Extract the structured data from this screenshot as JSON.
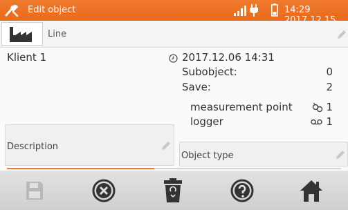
{
  "header": {
    "title": "Edit object",
    "datetime": "14:29 2017.12.15"
  },
  "line_field": {
    "label": "Line"
  },
  "object": {
    "client": "Klient 1",
    "created": "2017.12.06 14:31",
    "subobject_label": "Subobject:",
    "subobject_value": "0",
    "save_label": "Save:",
    "save_value": "2",
    "measurement_point_label": "measurement point",
    "measurement_point_value": "1",
    "logger_label": "logger",
    "logger_value": "1"
  },
  "description_field": {
    "label": "Description"
  },
  "object_type_field": {
    "label": "Object type"
  },
  "progress": {
    "fraction": 0.44
  },
  "colors": {
    "accent": "#ef7a2e",
    "toolbar_icon": "#333333",
    "disabled_icon": "#b8b8b8"
  },
  "toolbar": {
    "buttons": [
      "save-icon",
      "close-icon",
      "trash-icon",
      "help-icon",
      "home-icon"
    ]
  }
}
